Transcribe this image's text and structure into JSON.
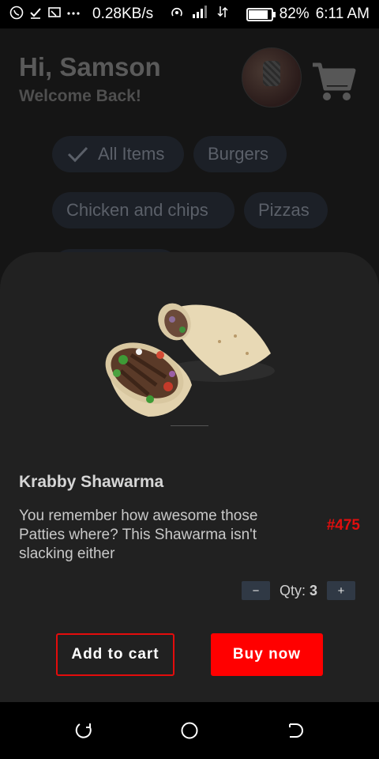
{
  "status_bar": {
    "net_speed": "0.28KB/s",
    "battery": "82%",
    "battery_level": 0.82,
    "time": "6:11 AM",
    "icons": [
      "whatsapp-icon",
      "check-icon",
      "cast-icon",
      "more-icon",
      "hotspot-icon",
      "signal-icon",
      "data-icon",
      "battery-icon"
    ]
  },
  "header": {
    "title": "Hi, Samson",
    "subtitle": "Welcome Back!"
  },
  "categories": {
    "all": "All Items",
    "burgers": "Burgers",
    "chicken": "Chicken and chips",
    "pizzas": "Pizzas"
  },
  "product": {
    "name": "Krabby Shawarma",
    "description": "You remember how awesome those Patties where? This Shawarma isn't slacking either",
    "price": "#475",
    "qty_label": "Qty:",
    "qty_value": "3",
    "minus": "−",
    "plus": "+"
  },
  "actions": {
    "add_to_cart": "Add to cart",
    "buy_now": "Buy now"
  },
  "colors": {
    "accent": "#ff0000",
    "price": "#e00e0e",
    "sheet": "#212121"
  }
}
